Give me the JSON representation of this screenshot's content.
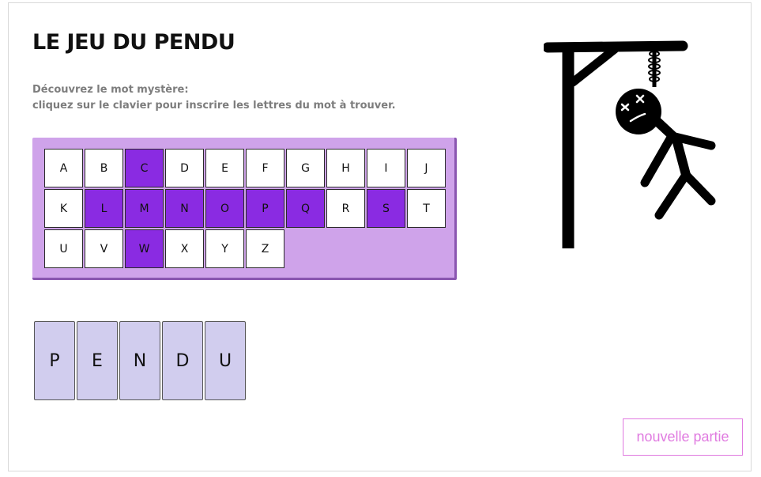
{
  "game": {
    "title": "LE JEU DU PENDU",
    "instructions_line1": "Découvrez le mot mystère:",
    "instructions_line2": "cliquez sur le clavier pour inscrire les lettres du mot à trouver.",
    "new_game_label": "nouvelle partie"
  },
  "keyboard": {
    "keys": [
      "A",
      "B",
      "C",
      "D",
      "E",
      "F",
      "G",
      "H",
      "I",
      "J",
      "K",
      "L",
      "M",
      "N",
      "O",
      "P",
      "Q",
      "R",
      "S",
      "T",
      "U",
      "V",
      "W",
      "X",
      "Y",
      "Z"
    ],
    "used_keys": [
      "C",
      "L",
      "M",
      "N",
      "O",
      "P",
      "Q",
      "S",
      "W"
    ],
    "used_color": "#8a2be2",
    "unused_color": "#ffffff",
    "panel_color": "#cfa3ea"
  },
  "word": {
    "letters": [
      "P",
      "E",
      "N",
      "D",
      "U"
    ],
    "tile_color": "#d1cdee"
  },
  "hangman": {
    "state": "complete",
    "icon_name": "hanged-man-icon"
  },
  "colors": {
    "accent_pink": "#e07be0",
    "instruction_gray": "#7d7d7d"
  }
}
